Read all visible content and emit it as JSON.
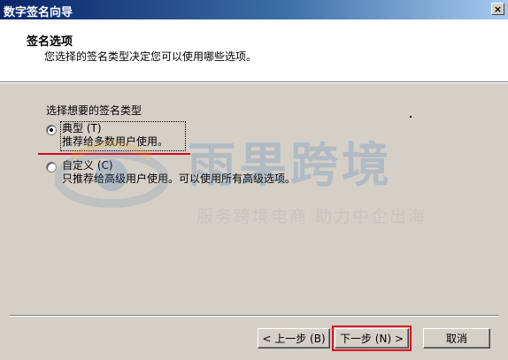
{
  "window": {
    "title": "数字签名向导",
    "close_label": "×"
  },
  "header": {
    "title": "签名选项",
    "subtitle": "您选择的签名类型决定您可以使用哪些选项。"
  },
  "body": {
    "group_label": "选择想要的签名类型",
    "options": [
      {
        "label": "典型 (T)",
        "description": "推荐给多数用户使用。",
        "selected": true
      },
      {
        "label": "自定义 (C)",
        "description": "只推荐给高级用户使用。可以使用所有高级选项。",
        "selected": false
      }
    ]
  },
  "watermark": {
    "brand": "雨果跨境",
    "tagline": "服务跨境电商 助力中企出海"
  },
  "buttons": {
    "back": "< 上一步 (B)",
    "next": "下一步 (N) >",
    "cancel": "取消"
  },
  "colors": {
    "titlebar": "#0a246a",
    "highlight": "#e0001a",
    "dialog": "#d4d0c8"
  }
}
